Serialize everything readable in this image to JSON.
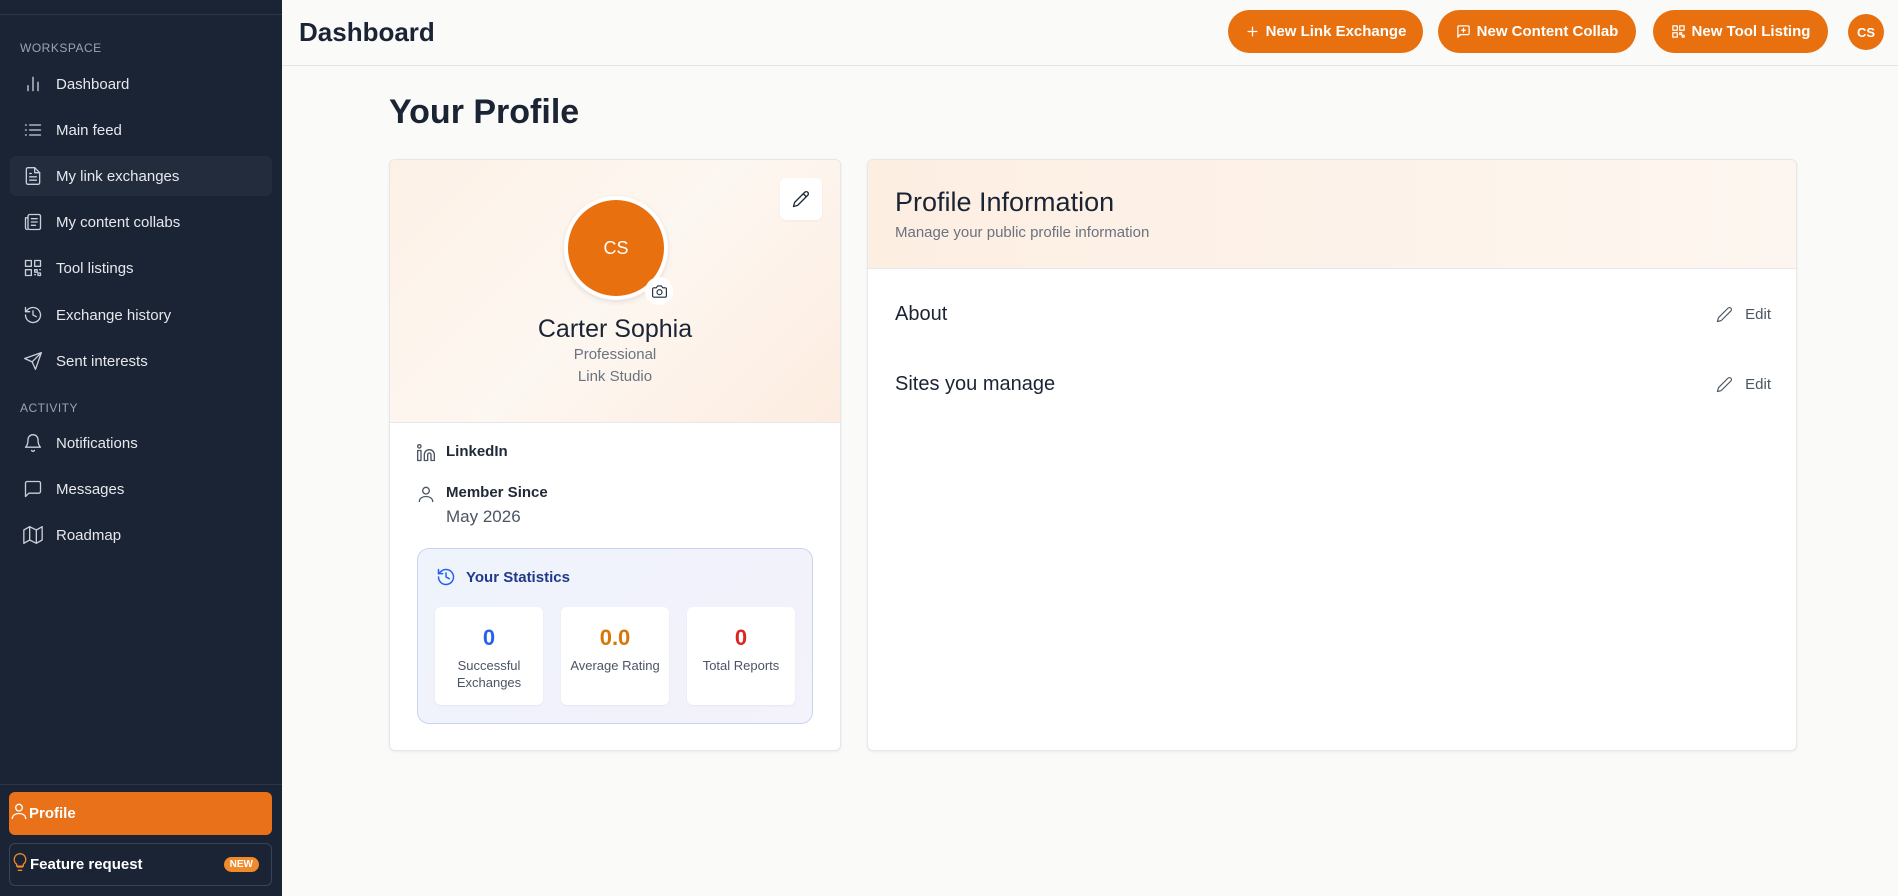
{
  "sidebar": {
    "sections": {
      "workspace": "WORKSPACE",
      "activity": "ACTIVITY"
    },
    "workspace_items": [
      {
        "label": "Dashboard",
        "icon": "bar-chart-icon"
      },
      {
        "label": "Main feed",
        "icon": "list-icon"
      },
      {
        "label": "My link exchanges",
        "icon": "document-icon"
      },
      {
        "label": "My content collabs",
        "icon": "newspaper-icon"
      },
      {
        "label": "Tool listings",
        "icon": "qr-grid-icon"
      },
      {
        "label": "Exchange history",
        "icon": "history-icon"
      },
      {
        "label": "Sent interests",
        "icon": "send-icon"
      }
    ],
    "activity_items": [
      {
        "label": "Notifications",
        "icon": "bell-icon"
      },
      {
        "label": "Messages",
        "icon": "message-icon"
      },
      {
        "label": "Roadmap",
        "icon": "map-icon"
      }
    ],
    "profile_label": "Profile",
    "feature_label": "Feature request",
    "feature_badge": "NEW"
  },
  "header": {
    "title": "Dashboard",
    "buttons": {
      "link_exchange": "New Link Exchange",
      "content_collab": "New Content Collab",
      "tool_listing": "New Tool Listing"
    },
    "avatar_initials": "CS"
  },
  "main": {
    "page_title": "Your Profile",
    "profile": {
      "initials": "CS",
      "name": "Carter Sophia",
      "role": "Professional",
      "company": "Link Studio",
      "linkedin_label": "LinkedIn",
      "member_since_label": "Member Since",
      "member_since_value": "May 2026"
    },
    "stats": {
      "title": "Your Statistics",
      "items": [
        {
          "value": "0",
          "label": "Successful Exchanges",
          "color": "#2563eb"
        },
        {
          "value": "0.0",
          "label": "Average Rating",
          "color": "#d97706"
        },
        {
          "value": "0",
          "label": "Total Reports",
          "color": "#dc2626"
        }
      ]
    },
    "info": {
      "title": "Profile Information",
      "subtitle": "Manage your public profile information",
      "sections": [
        {
          "title": "About",
          "edit": "Edit"
        },
        {
          "title": "Sites you manage",
          "edit": "Edit"
        }
      ]
    }
  },
  "colors": {
    "accent": "#e8700f",
    "sidebar_bg": "#1b2434"
  }
}
